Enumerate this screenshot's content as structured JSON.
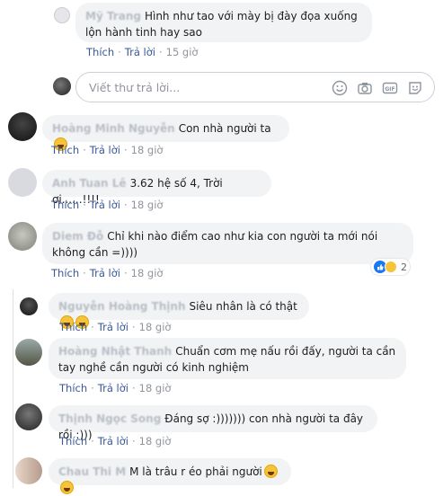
{
  "comments": [
    {
      "id": "c1",
      "name": "Mỹ Trang",
      "text": "Hình như tao với mày bị đày đọa xuống lộn hành tinh hay sao",
      "like": "Thích",
      "reply": "Trả lời",
      "time": "15 giờ"
    },
    {
      "id": "c2",
      "name": "Hoàng Minh Nguyễn",
      "text": "Con nhà người ta",
      "like": "Thích",
      "reply": "Trả lời",
      "time": "18 giờ"
    },
    {
      "id": "c3",
      "name": "Anh Tuan Lê",
      "text": "3.62 hệ số 4, Trời ơi......!!!!",
      "like": "Thích",
      "reply": "Trả lời",
      "time": "18 giờ"
    },
    {
      "id": "c4",
      "name": "Diem Đỗ",
      "text": "Chỉ khi nào điểm cao như kia con người ta mới nói không cần =))))",
      "like": "Thích",
      "reply": "Trả lời",
      "time": "18 giờ",
      "reaction_count": "2"
    },
    {
      "id": "c5",
      "name": "Nguyễn Hoàng Thịnh",
      "text": "Siêu nhân là có thật",
      "like": "Thích",
      "reply": "Trả lời",
      "time": "18 giờ"
    },
    {
      "id": "c6",
      "name": "Hoàng Nhật Thanh",
      "text": "Chuẩn cơm mẹ nấu rồi đấy, người ta cần tay nghề cần người có kinh nghiệm",
      "like": "Thích",
      "reply": "Trả lời",
      "time": "18 giờ"
    },
    {
      "id": "c7",
      "name": "Thịnh Ngọc Song",
      "text": "Đáng sợ :))))))) con nhà người ta đây rồi :)))",
      "like": "Thích",
      "reply": "Trả lời",
      "time": "18 giờ"
    },
    {
      "id": "c8",
      "name": "Chau Thi M",
      "text": "M là trâu r éo phải người",
      "like": "Thích",
      "reply": "Trả lời",
      "time": "18 giờ"
    }
  ],
  "reply_box": {
    "placeholder": "Viết thư trả lời..."
  },
  "icons": {
    "emoji": "smiley-icon",
    "camera": "camera-icon",
    "gif": "gif-icon",
    "sticker": "sticker-icon"
  },
  "colors": {
    "link": "#385898",
    "bubble": "#f2f3f5",
    "muted": "#90949c"
  }
}
